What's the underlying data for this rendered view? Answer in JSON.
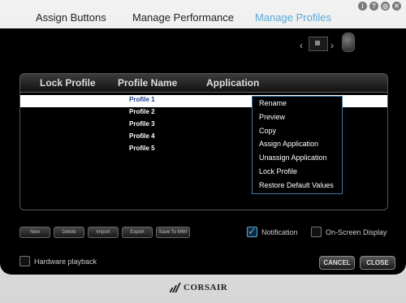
{
  "window_controls": [
    "i",
    "?",
    "◎",
    "✕"
  ],
  "tabs": [
    {
      "label": "Assign Buttons"
    },
    {
      "label": "Manage Performance"
    },
    {
      "label": "Manage Profiles"
    }
  ],
  "device_nav": {
    "prev": "‹",
    "next": "›"
  },
  "table": {
    "columns": [
      "Lock Profile",
      "Profile Name",
      "Application"
    ],
    "rows": [
      {
        "name": "Profile 1",
        "selected": true
      },
      {
        "name": "Profile 2",
        "selected": false
      },
      {
        "name": "Profile 3",
        "selected": false
      },
      {
        "name": "Profile 4",
        "selected": false
      },
      {
        "name": "Profile 5",
        "selected": false
      }
    ]
  },
  "context_menu": [
    "Rename",
    "Preview",
    "Copy",
    "Assign Application",
    "Unassign Application",
    "Lock Profile",
    "Restore Default Values"
  ],
  "buttons": {
    "new": "New",
    "delete": "Delete",
    "import": "Import",
    "export": "Export",
    "save_to_m60": "Save To M60",
    "cancel": "CANCEL",
    "close": "CLOSE"
  },
  "options": {
    "notification": {
      "label": "Notification",
      "checked": true
    },
    "osd": {
      "label": "On-Screen Display",
      "checked": false
    },
    "hardware_playback": {
      "label": "Hardware playback",
      "checked": false
    }
  },
  "brand": "CORSAIR",
  "colors": {
    "accent": "#5aa9d6",
    "selected_row": "#ffffff",
    "selected_text": "#1a3f8f"
  }
}
